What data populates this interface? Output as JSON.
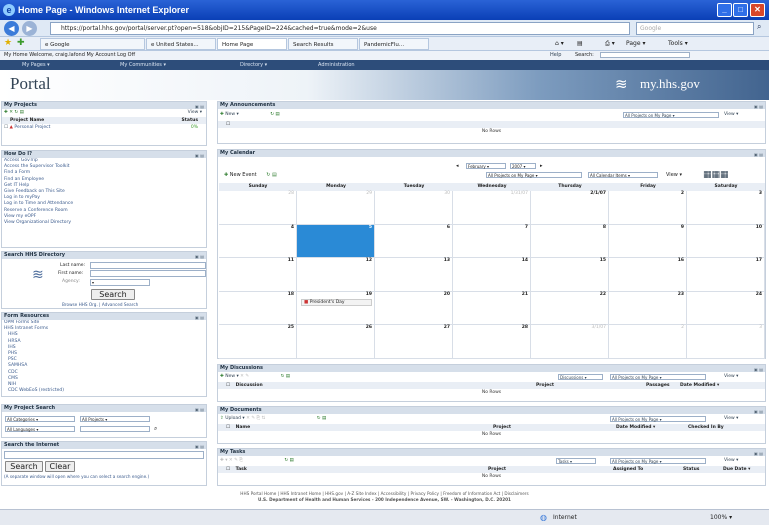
{
  "window": {
    "title": "Home Page - Windows Internet Explorer"
  },
  "address": {
    "url": "https://portal.hhs.gov/portal/server.pt?open=518&objID=215&PageID=224&cached=true&mode=2&use",
    "search_placeholder": "Google"
  },
  "ie_tabs": [
    {
      "label": "e Google"
    },
    {
      "label": "e United States..."
    },
    {
      "label": "Home Page"
    },
    {
      "label": "Search Results"
    },
    {
      "label": "PandemicFlu..."
    }
  ],
  "ie_commands": {
    "page": "Page",
    "tools": "Tools"
  },
  "portal": {
    "welcome": "My Home  Welcome, craig.lafond  My Account  Log Off",
    "help": "Help",
    "search_label": "Search:",
    "nav": [
      "My Pages",
      "My Communities",
      "Directory",
      "Administration"
    ],
    "title": "Portal",
    "logo": "my.hhs.gov"
  },
  "projects": {
    "title": "My Projects",
    "view": "View",
    "col_name": "Project Name",
    "col_status": "Status",
    "rows": [
      {
        "name": "Personal Project",
        "status": "0%"
      }
    ]
  },
  "howdoi": {
    "title": "How Do I?",
    "links": [
      "Access GovTrip",
      "Access the Supervisor Toolkit",
      "Find a Form",
      "Find an Employee",
      "Get IT Help",
      "Give Feedback on This Site",
      "Log in to myPay",
      "Log in to Time and Attendance",
      "Reserve a Conference Room",
      "View my eOPF",
      "View Organizational Directory"
    ]
  },
  "directory": {
    "title": "Search HHS Directory",
    "last_name": "Last name:",
    "first_name": "First name:",
    "agency": "Agency:",
    "search": "Search",
    "browse": "Browse HHS Org. | Advanced Search"
  },
  "forms": {
    "title": "Form Resources",
    "links": [
      "OPM Forms Site",
      "HHS Intranet Forms",
      "HHS",
      "HRSA",
      "IHS",
      "PHS",
      "PSC",
      "SAMHSA",
      "CDC",
      "CMS",
      "NIH",
      "CDC WebEoS (restricted)"
    ]
  },
  "proj_search": {
    "title": "My Project Search",
    "cat": "All Categories",
    "proj": "All Projects",
    "lang": "All Languages"
  },
  "internet": {
    "title": "Search the Internet",
    "search": "Search",
    "clear": "Clear",
    "note": "(A separate window will open where you can select a search engine.)"
  },
  "announcements": {
    "title": "My Announcements",
    "new": "New",
    "filter": "All Projects on My Page",
    "view": "View",
    "no_rows": "No Rows"
  },
  "calendar": {
    "title": "My Calendar",
    "month": "February",
    "year": "2007",
    "new_event": "New Event",
    "filter": "All Projects on My Page",
    "items": "All Calendar Items",
    "view": "View",
    "days": [
      "Sunday",
      "Monday",
      "Tuesday",
      "Wednesday",
      "Thursday",
      "Friday",
      "Saturday"
    ],
    "weeks": [
      [
        "28",
        "29",
        "30",
        "1/31/07",
        "2/1/07",
        "2",
        "3"
      ],
      [
        "4",
        "5",
        "6",
        "7",
        "8",
        "9",
        "10"
      ],
      [
        "11",
        "12",
        "13",
        "14",
        "15",
        "16",
        "17"
      ],
      [
        "18",
        "19",
        "20",
        "21",
        "22",
        "23",
        "24"
      ],
      [
        "25",
        "26",
        "27",
        "28",
        "3/1/07",
        "2",
        "3"
      ]
    ],
    "event": "President's Day"
  },
  "discussions": {
    "title": "My Discussions",
    "new": "New",
    "type": "Discussions",
    "filter": "All Projects on My Page",
    "view": "View",
    "cols": [
      "Discussion",
      "Project",
      "Passages",
      "Date Modified"
    ],
    "no_rows": "No Rows"
  },
  "documents": {
    "title": "My Documents",
    "upload": "Upload",
    "filter": "All Projects on My Page",
    "view": "View",
    "cols": [
      "Name",
      "Project",
      "Date Modified",
      "Checked In By"
    ],
    "no_rows": "No Rows"
  },
  "tasks": {
    "title": "My Tasks",
    "type": "Tasks",
    "filter": "All Projects on My Page",
    "view": "View",
    "cols": [
      "Task",
      "Project",
      "Assigned To",
      "Status",
      "Due Date"
    ],
    "no_rows": "No Rows"
  },
  "footer": {
    "line1": "HHS Portal Home | HHS Intranet Home | HHS.gov | A-Z Site Index | Accessibility | Privacy Policy | Freedom of Information Act | Disclaimers",
    "line2": "U.S. Department of Health and Human Services - 200 Independence Avenue, SW. - Washington, D.C. 20201"
  },
  "status": {
    "zone": "Internet",
    "zoom": "100%"
  }
}
